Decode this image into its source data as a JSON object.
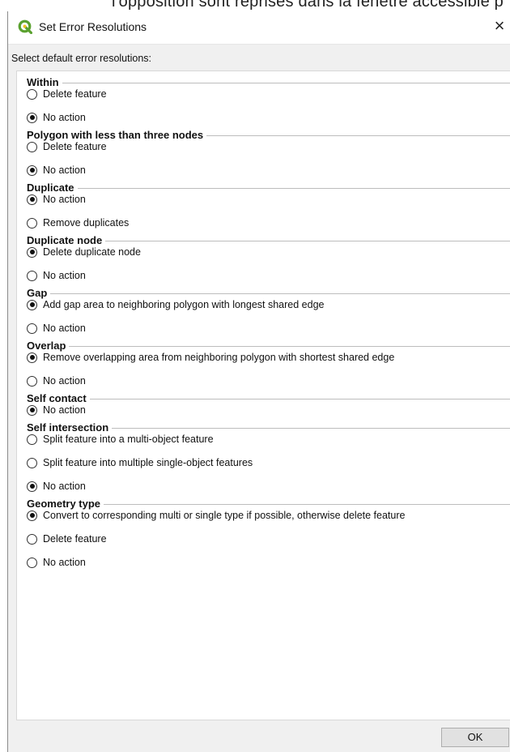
{
  "background_text": "l'opposition sont reprises dans la fenêtre accessible p",
  "dialog": {
    "title": "Set Error Resolutions",
    "close_glyph": "×",
    "instruction": "Select default error resolutions:",
    "ok_label": "OK"
  },
  "groups": [
    {
      "label": "Within",
      "options": [
        {
          "label": "Delete feature",
          "checked": false
        },
        {
          "label": "No action",
          "checked": true
        }
      ]
    },
    {
      "label": "Polygon with less than three nodes",
      "options": [
        {
          "label": "Delete feature",
          "checked": false
        },
        {
          "label": "No action",
          "checked": true
        }
      ]
    },
    {
      "label": "Duplicate",
      "options": [
        {
          "label": "No action",
          "checked": true
        },
        {
          "label": "Remove duplicates",
          "checked": false
        }
      ]
    },
    {
      "label": "Duplicate node",
      "options": [
        {
          "label": "Delete duplicate node",
          "checked": true
        },
        {
          "label": "No action",
          "checked": false
        }
      ]
    },
    {
      "label": "Gap",
      "options": [
        {
          "label": "Add gap area to neighboring polygon with longest shared edge",
          "checked": true
        },
        {
          "label": "No action",
          "checked": false
        }
      ]
    },
    {
      "label": "Overlap",
      "options": [
        {
          "label": "Remove overlapping area from neighboring polygon with shortest shared edge",
          "checked": true
        },
        {
          "label": "No action",
          "checked": false
        }
      ]
    },
    {
      "label": "Self contact",
      "options": [
        {
          "label": "No action",
          "checked": true
        }
      ]
    },
    {
      "label": "Self intersection",
      "options": [
        {
          "label": "Split feature into a multi-object feature",
          "checked": false
        },
        {
          "label": "Split feature into multiple single-object features",
          "checked": false
        },
        {
          "label": "No action",
          "checked": true
        }
      ]
    },
    {
      "label": "Geometry type",
      "options": [
        {
          "label": "Convert to corresponding multi or single type if possible, otherwise delete feature",
          "checked": true
        },
        {
          "label": "Delete feature",
          "checked": false
        },
        {
          "label": "No action",
          "checked": false
        }
      ]
    }
  ],
  "colors": {
    "qgis_green": "#5aa12f",
    "panel_bg": "#ffffff",
    "dialog_bg": "#f0f0f0"
  }
}
